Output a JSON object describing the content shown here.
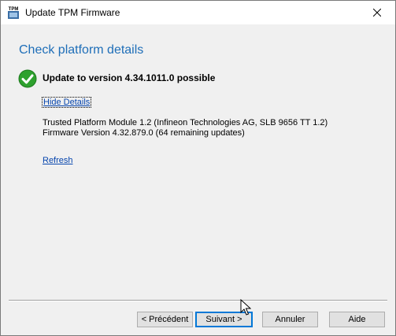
{
  "window": {
    "title": "Update TPM Firmware",
    "icon": "tpm-icon",
    "icon_text": "TPM",
    "close": "close-icon"
  },
  "main": {
    "heading": "Check platform details",
    "status_icon": "check-circle-icon",
    "status_text": "Update to version 4.34.1011.0 possible",
    "hide_details_link": "Hide Details",
    "details": [
      "Trusted Platform Module 1.2 (Infineon Technologies AG, SLB 9656 TT 1.2)",
      "Firmware Version 4.32.879.0 (64 remaining updates)"
    ],
    "refresh_link": "Refresh"
  },
  "footer": {
    "previous": "< Précédent",
    "next": "Suivant >",
    "cancel": "Annuler",
    "help": "Aide"
  },
  "colors": {
    "heading": "#1e6eb8",
    "link": "#0645ad",
    "check": "#2ea12e",
    "focus": "#0078d7"
  }
}
